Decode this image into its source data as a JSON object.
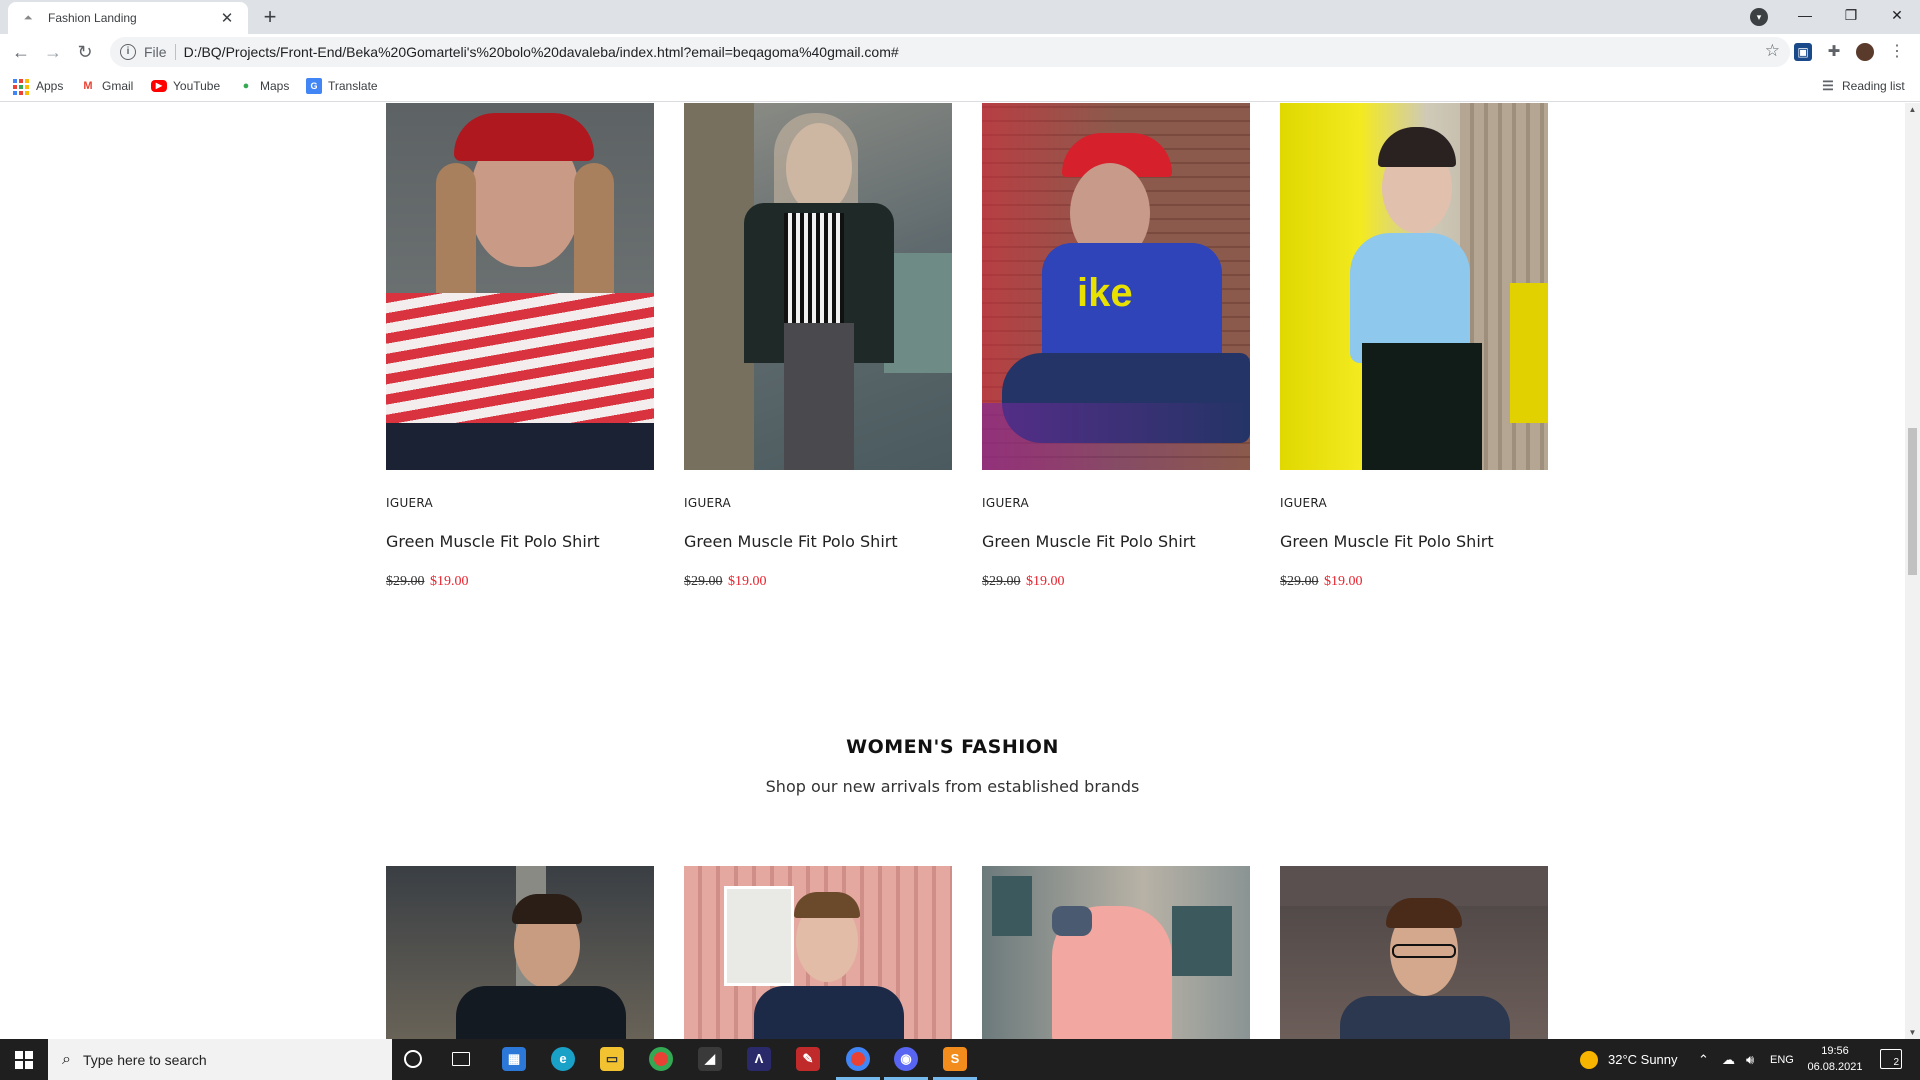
{
  "browser": {
    "tab_title": "Fashion Landing",
    "new_tab": "+",
    "close": "✕",
    "url_prefix": "File",
    "url": "D:/BQ/Projects/Front-End/Beka%20Gomarteli's%20bolo%20davaleba/index.html?email=beqagoma%40gmail.com#",
    "bookmarks": [
      "Apps",
      "Gmail",
      "YouTube",
      "Maps",
      "Translate"
    ],
    "reading_list": "Reading list"
  },
  "top_products": [
    {
      "brand": "IGUERA",
      "name": "Green Muscle Fit Polo Shirt",
      "old_price": "$29.00",
      "new_price": "$19.00"
    },
    {
      "brand": "IGUERA",
      "name": "Green Muscle Fit Polo Shirt",
      "old_price": "$29.00",
      "new_price": "$19.00"
    },
    {
      "brand": "IGUERA",
      "name": "Green Muscle Fit Polo Shirt",
      "old_price": "$29.00",
      "new_price": "$19.00"
    },
    {
      "brand": "IGUERA",
      "name": "Green Muscle Fit Polo Shirt",
      "old_price": "$29.00",
      "new_price": "$19.00"
    }
  ],
  "section": {
    "title": "WOMEN'S FASHION",
    "subtitle": "Shop our new arrivals from established brands"
  },
  "taskbar": {
    "search_placeholder": "Type here to search",
    "weather": "32°C  Sunny",
    "language": "ENG",
    "time": "19:56",
    "date": "06.08.2021",
    "notifications": "2"
  },
  "colors": {
    "sale_price": "#e8222d",
    "tab_strip": "#dee1e6",
    "taskbar": "#1f1f1f"
  }
}
